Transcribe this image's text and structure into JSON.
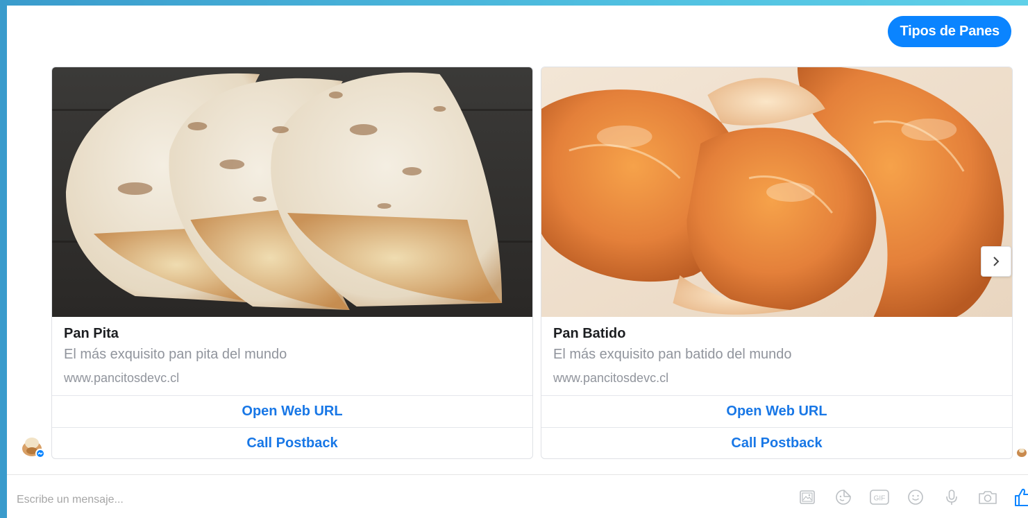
{
  "conversation": {
    "user_message": "Tipos de Panes"
  },
  "cards": [
    {
      "title": "Pan Pita",
      "subtitle": "El más exquisito pan pita del mundo",
      "url": "www.pancitosdevc.cl",
      "buttons": [
        "Open Web URL",
        "Call Postback"
      ]
    },
    {
      "title": "Pan Batido",
      "subtitle": "El más exquisito pan batido del mundo",
      "url": "www.pancitosdevc.cl",
      "buttons": [
        "Open Web URL",
        "Call Postback"
      ]
    }
  ],
  "composer": {
    "placeholder": "Escribe un mensaje...",
    "tools": [
      "image-icon",
      "sticker-icon",
      "gif-icon",
      "emoji-icon",
      "microphone-icon",
      "camera-icon",
      "like-icon"
    ]
  },
  "colors": {
    "accent": "#0a84ff",
    "link": "#1877e6"
  }
}
